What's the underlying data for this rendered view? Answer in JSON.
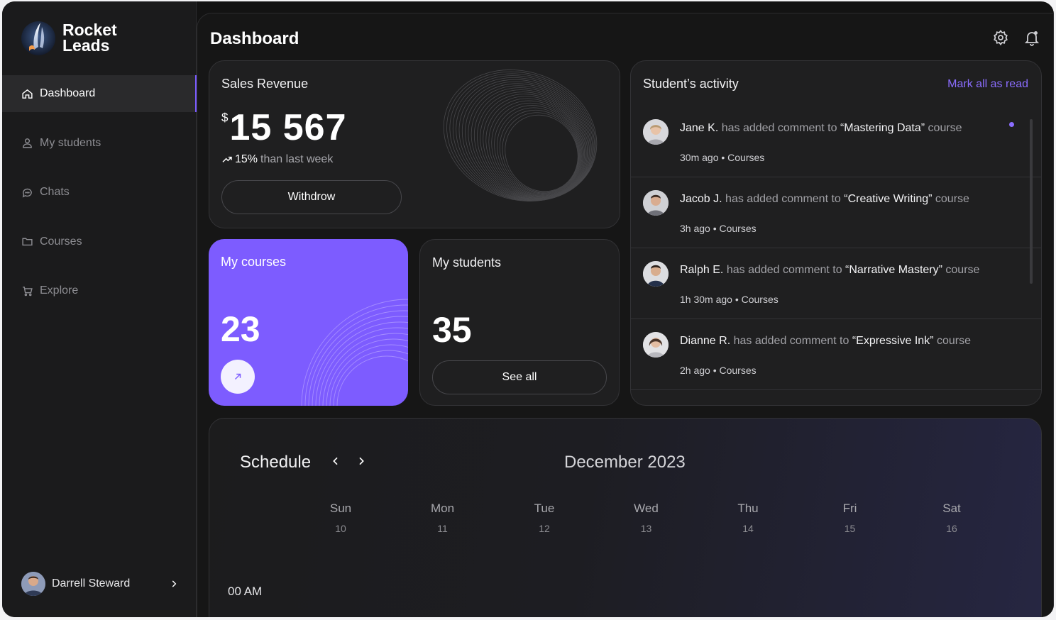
{
  "brand": {
    "line1": "Rocket",
    "line2": "Leads"
  },
  "sidebar": {
    "items": [
      {
        "label": "Dashboard",
        "icon": "home-icon",
        "active": true
      },
      {
        "label": "My students",
        "icon": "users-icon",
        "active": false
      },
      {
        "label": "Chats",
        "icon": "chat-icon",
        "active": false
      },
      {
        "label": "Courses",
        "icon": "folder-icon",
        "active": false
      },
      {
        "label": "Explore",
        "icon": "cart-icon",
        "active": false
      }
    ],
    "user": {
      "name": "Darrell Steward"
    }
  },
  "header": {
    "title": "Dashboard"
  },
  "sales": {
    "title": "Sales Revenue",
    "currency": "$",
    "amount": "15 567",
    "trend_value": "15%",
    "trend_text": "than last week",
    "button": "Withdrow"
  },
  "courses": {
    "title": "My courses",
    "count": "23"
  },
  "students": {
    "title": "My students",
    "count": "35",
    "button": "See all"
  },
  "activity": {
    "title": "Student’s activity",
    "mark_all": "Mark all as read",
    "items": [
      {
        "name": "Jane K.",
        "action": "has added comment to",
        "course": "“Mastering Data”",
        "suffix": "course",
        "meta": "30m ago • Courses",
        "unread": true
      },
      {
        "name": "Jacob J.",
        "action": "has added comment to",
        "course": "“Creative Writing”",
        "suffix": "course",
        "meta": "3h ago • Courses",
        "unread": false
      },
      {
        "name": "Ralph E.",
        "action": "has added comment to",
        "course": "“Narrative Mastery”",
        "suffix": "course",
        "meta": "1h 30m ago • Courses",
        "unread": false
      },
      {
        "name": "Dianne R.",
        "action": "has added comment to",
        "course": "“Expressive Ink”",
        "suffix": "course",
        "meta": "2h ago • Courses",
        "unread": false
      }
    ]
  },
  "schedule": {
    "title": "Schedule",
    "month": "December 2023",
    "days": [
      {
        "name": "Sun",
        "date": "10"
      },
      {
        "name": "Mon",
        "date": "11"
      },
      {
        "name": "Tue",
        "date": "12"
      },
      {
        "name": "Wed",
        "date": "13"
      },
      {
        "name": "Thu",
        "date": "14"
      },
      {
        "name": "Fri",
        "date": "15"
      },
      {
        "name": "Sat",
        "date": "16"
      }
    ],
    "time_label": "00 AM"
  },
  "colors": {
    "accent": "#7d5cff",
    "background": "#131313",
    "card": "#1f1f20"
  }
}
